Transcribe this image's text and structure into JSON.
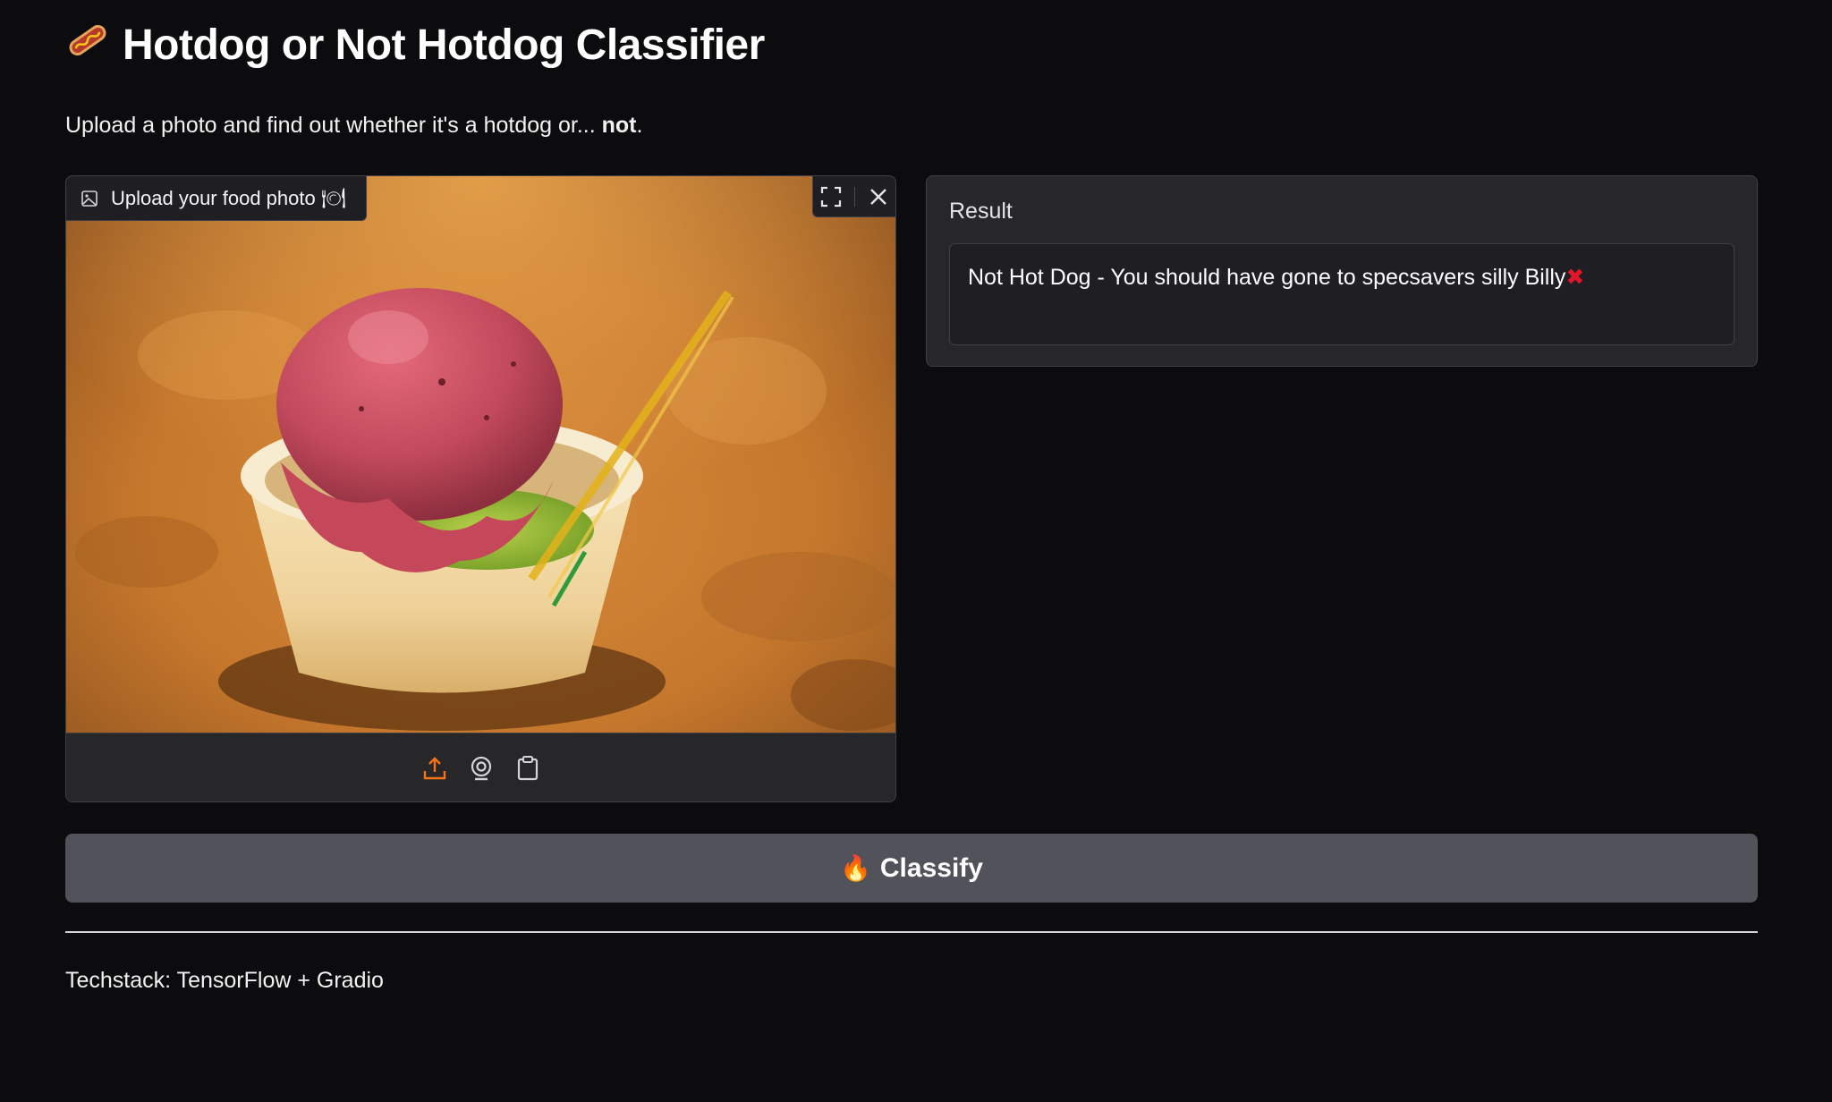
{
  "header": {
    "emoji_icon": "hotdog-icon",
    "title": "Hotdog or Not Hotdog Classifier",
    "subtitle_prefix": "Upload a photo and find out whether it's a hotdog or... ",
    "subtitle_bold": "not",
    "subtitle_suffix": "."
  },
  "image_input": {
    "label": "Upload your food photo",
    "label_emoji": "🍽",
    "fullscreen_icon": "fullscreen-icon",
    "clear_icon": "close-icon",
    "sources": [
      "upload-icon",
      "webcam-icon",
      "clipboard-icon"
    ],
    "accent_color": "#f97316"
  },
  "result": {
    "label": "Result",
    "text": "Not Hot Dog - You should have gone to specsavers silly Billy",
    "mark": "✖",
    "mark_color": "#e0162b"
  },
  "classify_button": {
    "emoji": "🔥",
    "label": "Classify"
  },
  "footer": {
    "text": "Techstack: TensorFlow + Gradio"
  }
}
